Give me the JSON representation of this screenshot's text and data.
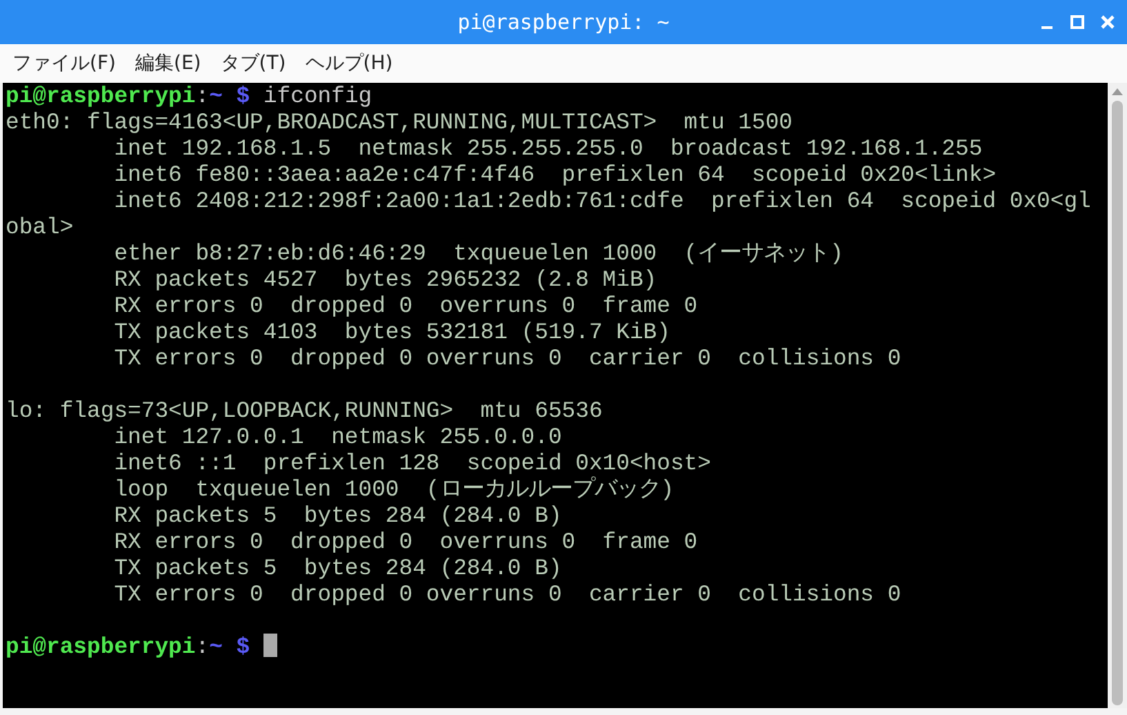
{
  "window": {
    "title": "pi@raspberrypi: ~"
  },
  "menu": [
    "ファイル(F)",
    "編集(E)",
    "タブ(T)",
    "ヘルプ(H)"
  ],
  "terminal": {
    "lines": [
      {
        "kind": "prompt",
        "user": "pi@raspberrypi",
        "separator": ":",
        "path": "~",
        "symbol": "$",
        "command": "ifconfig"
      },
      {
        "kind": "output",
        "text": "eth0: flags=4163<UP,BROADCAST,RUNNING,MULTICAST>  mtu 1500"
      },
      {
        "kind": "detail",
        "text": "inet 192.168.1.5  netmask 255.255.255.0  broadcast 192.168.1.255"
      },
      {
        "kind": "detail",
        "text": "inet6 fe80::3aea:aa2e:c47f:4f46  prefixlen 64  scopeid 0x20<link>"
      },
      {
        "kind": "detail",
        "text": "inet6 2408:212:298f:2a00:1a1:2edb:761:cdfe  prefixlen 64  scopeid 0x0<gl"
      },
      {
        "kind": "output",
        "text": "obal>"
      },
      {
        "kind": "detail",
        "text": "ether b8:27:eb:d6:46:29  txqueuelen 1000  (イーサネット)"
      },
      {
        "kind": "detail",
        "text": "RX packets 4527  bytes 2965232 (2.8 MiB)"
      },
      {
        "kind": "detail",
        "text": "RX errors 0  dropped 0  overruns 0  frame 0"
      },
      {
        "kind": "detail",
        "text": "TX packets 4103  bytes 532181 (519.7 KiB)"
      },
      {
        "kind": "detail",
        "text": "TX errors 0  dropped 0 overruns 0  carrier 0  collisions 0"
      },
      {
        "kind": "blank"
      },
      {
        "kind": "output",
        "text": "lo: flags=73<UP,LOOPBACK,RUNNING>  mtu 65536"
      },
      {
        "kind": "detail",
        "text": "inet 127.0.0.1  netmask 255.0.0.0"
      },
      {
        "kind": "detail",
        "text": "inet6 ::1  prefixlen 128  scopeid 0x10<host>"
      },
      {
        "kind": "detail",
        "text": "loop  txqueuelen 1000  (ローカルループバック)"
      },
      {
        "kind": "detail",
        "text": "RX packets 5  bytes 284 (284.0 B)"
      },
      {
        "kind": "detail",
        "text": "RX errors 0  dropped 0  overruns 0  frame 0"
      },
      {
        "kind": "detail",
        "text": "TX packets 5  bytes 284 (284.0 B)"
      },
      {
        "kind": "detail",
        "text": "TX errors 0  dropped 0 overruns 0  carrier 0  collisions 0"
      },
      {
        "kind": "blank"
      },
      {
        "kind": "prompt",
        "user": "pi@raspberrypi",
        "separator": ":",
        "path": "~",
        "symbol": "$",
        "cursor": true
      }
    ]
  }
}
